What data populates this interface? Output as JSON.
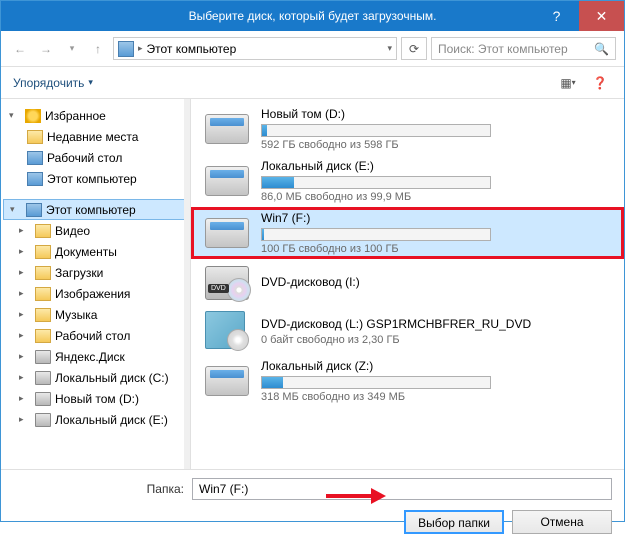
{
  "title": "Выберите диск, который будет загрузочным.",
  "breadcrumb": "Этот компьютер",
  "search_placeholder": "Поиск: Этот компьютер",
  "organize": "Упорядочить",
  "tree": {
    "favorites": "Избранное",
    "recent": "Недавние места",
    "desktop": "Рабочий стол",
    "thispc_fav": "Этот компьютер",
    "thispc": "Этот компьютер",
    "videos": "Видео",
    "documents": "Документы",
    "downloads": "Загрузки",
    "pictures": "Изображения",
    "music": "Музыка",
    "desktop2": "Рабочий стол",
    "yandex": "Яндекс.Диск",
    "localC": "Локальный диск (C:)",
    "newvolD": "Новый том (D:)",
    "localE": "Локальный диск (E:)"
  },
  "drives": [
    {
      "name": "Новый том (D:)",
      "free": "592 ГБ свободно из 598 ГБ",
      "fill": 2,
      "type": "hdd"
    },
    {
      "name": "Локальный диск (E:)",
      "free": "86,0 МБ свободно из 99,9 МБ",
      "fill": 14,
      "type": "hdd"
    },
    {
      "name": "Win7 (F:)",
      "free": "100 ГБ свободно из 100 ГБ",
      "fill": 1,
      "type": "hdd",
      "selected": true,
      "highlight": true
    },
    {
      "name": "DVD-дисковод (I:)",
      "free": "",
      "type": "dvd-empty"
    },
    {
      "name": "DVD-дисковод (L:) GSP1RMCHBFRER_RU_DVD",
      "free": "0 байт свободно из 2,30 ГБ",
      "type": "dvd-full"
    },
    {
      "name": "Локальный диск (Z:)",
      "free": "318 МБ свободно из 349 МБ",
      "fill": 9,
      "type": "hdd"
    }
  ],
  "folder_label": "Папка:",
  "folder_value": "Win7 (F:)",
  "select_btn": "Выбор папки",
  "cancel_btn": "Отмена"
}
